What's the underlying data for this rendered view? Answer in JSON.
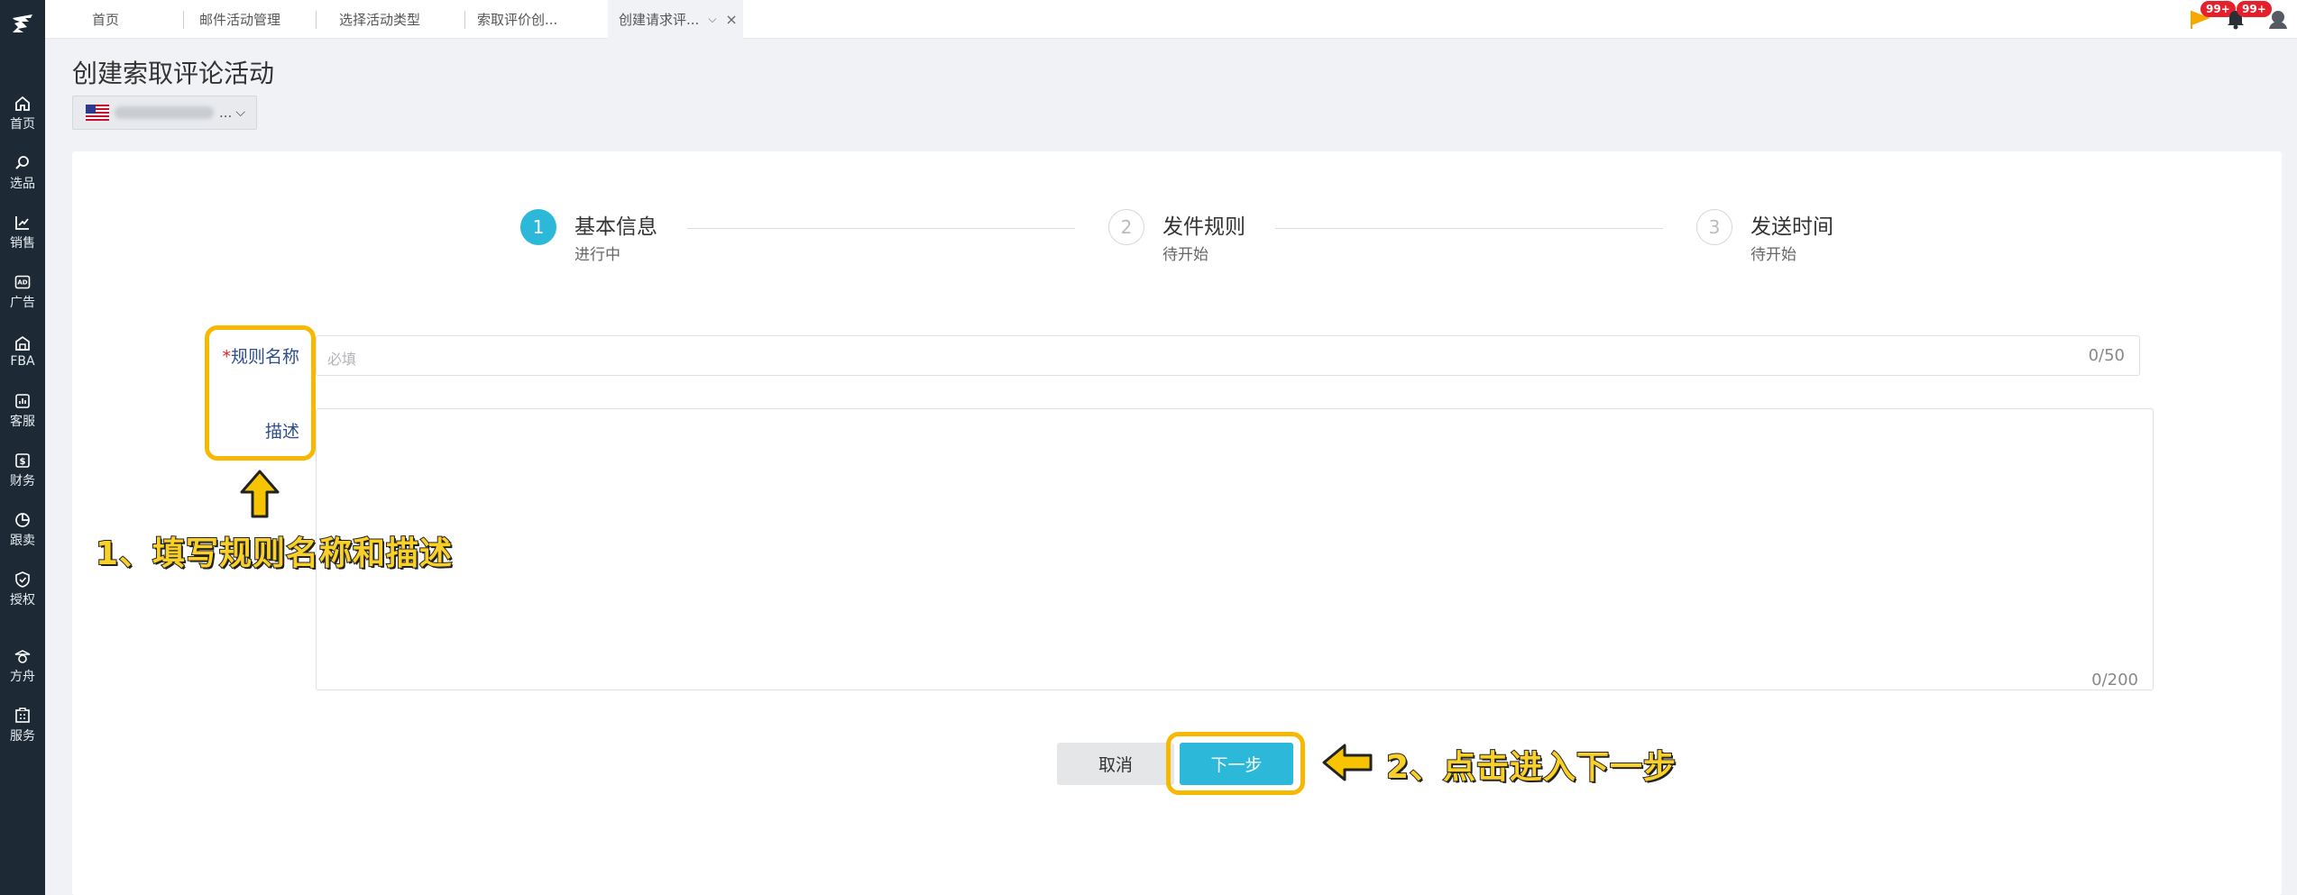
{
  "sidebar": {
    "items": [
      {
        "label": "首页",
        "icon": "home-icon"
      },
      {
        "label": "选品",
        "icon": "search-icon"
      },
      {
        "label": "销售",
        "icon": "chart-line-icon"
      },
      {
        "label": "广告",
        "icon": "ad-icon"
      },
      {
        "label": "FBA",
        "icon": "warehouse-icon"
      },
      {
        "label": "客服",
        "icon": "service-chart-icon"
      },
      {
        "label": "财务",
        "icon": "finance-icon"
      },
      {
        "label": "跟卖",
        "icon": "pie-chart-icon"
      },
      {
        "label": "授权",
        "icon": "shield-check-icon"
      },
      {
        "label": "方舟",
        "icon": "ark-icon"
      },
      {
        "label": "服务",
        "icon": "building-icon"
      }
    ]
  },
  "tabs": [
    {
      "label": "首页"
    },
    {
      "label": "邮件活动管理"
    },
    {
      "label": "选择活动类型"
    },
    {
      "label": "索取评价创..."
    },
    {
      "label": "创建请求评...",
      "active": true
    }
  ],
  "topbar": {
    "flag_badge": "99+",
    "bell_badge": "99+"
  },
  "page": {
    "title": "创建索取评论活动",
    "store_suffix": "...",
    "store_flag": "US"
  },
  "steps": [
    {
      "num": "1",
      "title": "基本信息",
      "status": "进行中"
    },
    {
      "num": "2",
      "title": "发件规则",
      "status": "待开始"
    },
    {
      "num": "3",
      "title": "发送时间",
      "status": "待开始"
    }
  ],
  "form": {
    "name_required_mark": "*",
    "name_label": "规则名称",
    "name_placeholder": "必填",
    "name_count": "0/50",
    "desc_label": "描述",
    "desc_count": "0/200"
  },
  "buttons": {
    "cancel": "取消",
    "next": "下一步"
  },
  "annotations": {
    "step1": "1、填写规则名称和描述",
    "step2": "2、点击进入下一步"
  },
  "colors": {
    "sidebar_bg": "#1d2a36",
    "accent": "#2cb8d8",
    "highlight": "#f6b800",
    "badge": "#e5202a"
  }
}
